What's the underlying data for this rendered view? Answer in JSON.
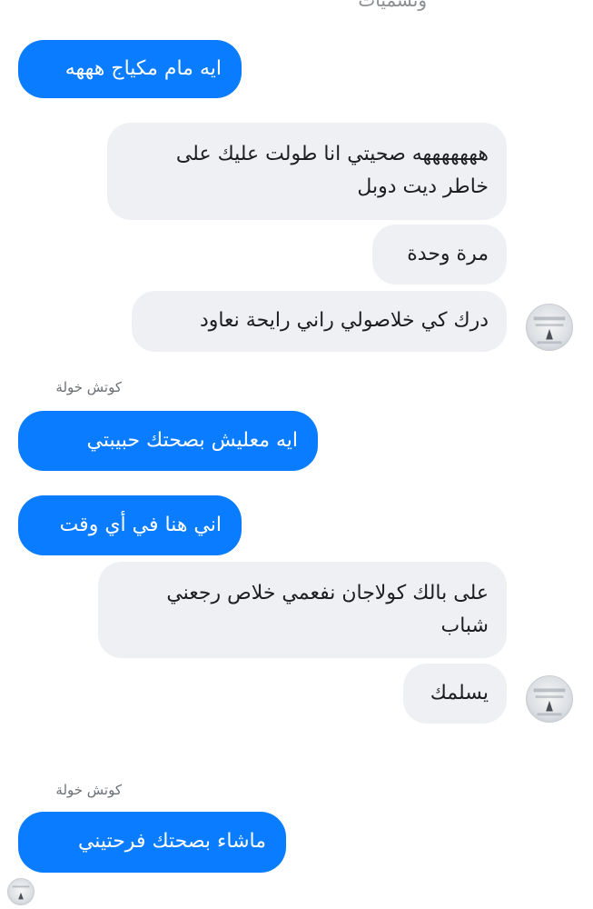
{
  "top_text": "وتسميات",
  "messages": {
    "m1": "ايه مام مكياج هههه",
    "m2_line1": "هههههههه صحيتي انا طولت عليك على",
    "m2_line2": "خاطر ديت دوبل",
    "m3": "مرة وحدة",
    "m4": "درك كي خلاصولي راني رايحة نعاود",
    "sender1": "كوتش خولة",
    "m5": "ايه معليش بصحتك حبيبتي",
    "m6": "اني هنا في أي وقت",
    "m7_line1": "على بالك كولاجان نفعمي خلاص رجعني",
    "m7_line2": "شباب",
    "m8": "يسلمك",
    "sender2": "كوتش خولة",
    "m9": "ماشاء بصحتك فرحتيني"
  },
  "colors": {
    "sent_bubble": "#0a7cff",
    "received_bubble": "#eef0f3",
    "sender_label": "#6b6f75"
  },
  "icons": {
    "avatar": "profile-avatar-icon"
  }
}
